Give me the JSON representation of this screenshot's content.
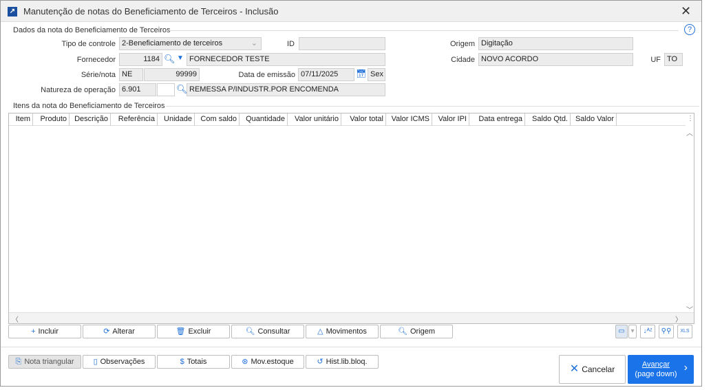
{
  "window": {
    "title": "Manutenção de notas do Beneficiamento de Terceiros - Inclusão"
  },
  "section1": {
    "title": "Dados da nota do Beneficiamento de Terceiros"
  },
  "form": {
    "tipo_label": "Tipo de controle",
    "tipo_value": "2-Beneficiamento de terceiros",
    "id_label": "ID",
    "id_value": "",
    "origem_label": "Origem",
    "origem_value": "Digitação",
    "fornecedor_label": "Fornecedor",
    "fornecedor_code": "1184",
    "fornecedor_name": "FORNECEDOR TESTE",
    "cidade_label": "Cidade",
    "cidade_value": "NOVO ACORDO",
    "uf_label": "UF",
    "uf_value": "TO",
    "serie_label": "Série/nota",
    "serie_value": "NE",
    "nota_value": "99999",
    "data_label": "Data de emissão",
    "data_value": "07/11/2025",
    "dia_value": "Sex",
    "natureza_label": "Natureza de operação",
    "natureza_code": "6.901",
    "natureza_sub": "",
    "natureza_desc": "REMESSA P/INDUSTR.POR ENCOMENDA"
  },
  "section2": {
    "title": "Itens da nota do Beneficiamento de Terceiros"
  },
  "columns": [
    "Item",
    "Produto",
    "Descrição",
    "Referência",
    "Unidade",
    "Com saldo",
    "Quantidade",
    "Valor unitário",
    "Valor total",
    "Valor ICMS",
    "Valor IPI",
    "Data entrega",
    "Saldo Qtd.",
    "Saldo Valor"
  ],
  "item_buttons": [
    "Incluir",
    "Alterar",
    "Excluir",
    "Consultar",
    "Movimentos",
    "Origem"
  ],
  "footer_buttons": [
    "Nota triangular",
    "Observações",
    "Totais",
    "Mov.estoque",
    "Hist.lib.bloq."
  ],
  "cancel_label": "Cancelar",
  "advance_label": "Avançar",
  "advance_sub": "(page down)",
  "xls_label": "XLS",
  "colors": {
    "accent": "#1e6fd9",
    "primary_btn": "#1a73e8"
  }
}
